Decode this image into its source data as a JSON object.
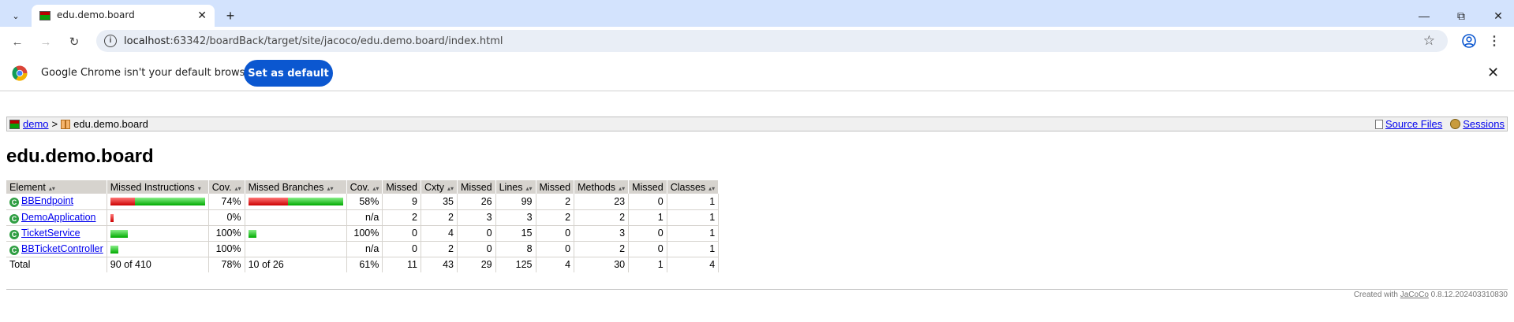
{
  "browser": {
    "tab_title": "edu.demo.board",
    "url_host": "localhost",
    "url_path": ":63342/boardBack/target/site/jacoco/edu.demo.board/index.html",
    "infobar_text": "Google Chrome isn't your default browser",
    "set_default_label": "Set as default"
  },
  "breadcrumb": {
    "root": "demo",
    "separator": ">",
    "current": "edu.demo.board",
    "source_files": "Source Files",
    "sessions": "Sessions"
  },
  "page": {
    "title": "edu.demo.board"
  },
  "table": {
    "headers": [
      "Element",
      "Missed Instructions",
      "Cov.",
      "Missed Branches",
      "Cov.",
      "Missed",
      "Cxty",
      "Missed",
      "Lines",
      "Missed",
      "Methods",
      "Missed",
      "Classes"
    ],
    "rows": [
      {
        "name": "BBEndpoint",
        "instr_missed_ratio": 0.26,
        "instr_total_ratio": 1.0,
        "instr_cov": "74%",
        "br_missed_ratio": 0.42,
        "br_total_ratio": 1.0,
        "br_cov": "58%",
        "cxty_missed": "9",
        "cxty": "35",
        "lines_missed": "26",
        "lines": "99",
        "methods_missed": "2",
        "methods": "23",
        "classes_missed": "0",
        "classes": "1"
      },
      {
        "name": "DemoApplication",
        "instr_missed_ratio": 0.03,
        "instr_total_ratio": 0.03,
        "instr_cov": "0%",
        "br_missed_ratio": 0,
        "br_total_ratio": 0,
        "br_cov": "n/a",
        "cxty_missed": "2",
        "cxty": "2",
        "lines_missed": "3",
        "lines": "3",
        "methods_missed": "2",
        "methods": "2",
        "classes_missed": "1",
        "classes": "1"
      },
      {
        "name": "TicketService",
        "instr_missed_ratio": 0,
        "instr_total_ratio": 0.18,
        "instr_cov": "100%",
        "br_missed_ratio": 0,
        "br_total_ratio": 0.08,
        "br_cov": "100%",
        "cxty_missed": "0",
        "cxty": "4",
        "lines_missed": "0",
        "lines": "15",
        "methods_missed": "0",
        "methods": "3",
        "classes_missed": "0",
        "classes": "1"
      },
      {
        "name": "BBTicketController",
        "instr_missed_ratio": 0,
        "instr_total_ratio": 0.08,
        "instr_cov": "100%",
        "br_missed_ratio": 0,
        "br_total_ratio": 0,
        "br_cov": "n/a",
        "cxty_missed": "0",
        "cxty": "2",
        "lines_missed": "0",
        "lines": "8",
        "methods_missed": "0",
        "methods": "2",
        "classes_missed": "0",
        "classes": "1"
      }
    ],
    "total": {
      "label": "Total",
      "instr": "90 of 410",
      "instr_cov": "78%",
      "br": "10 of 26",
      "br_cov": "61%",
      "cxty_missed": "11",
      "cxty": "43",
      "lines_missed": "29",
      "lines": "125",
      "methods_missed": "4",
      "methods": "30",
      "classes_missed": "1",
      "classes": "4"
    }
  },
  "footer": {
    "prefix": "Created with",
    "tool": "JaCoCo",
    "version": "0.8.12.202403310830"
  }
}
